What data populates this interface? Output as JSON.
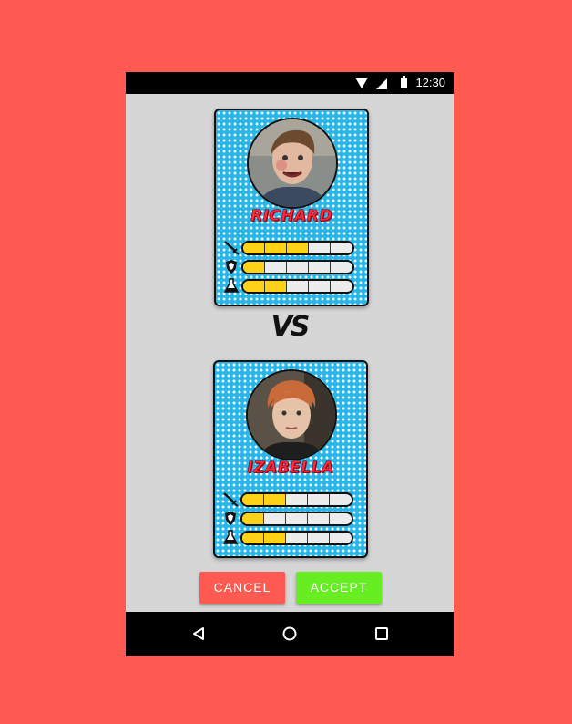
{
  "status_bar": {
    "time": "12:30",
    "icons": [
      "wifi-icon",
      "cell-signal-icon",
      "battery-icon"
    ]
  },
  "cards": [
    {
      "name": "RICHARD",
      "stats": [
        {
          "icon": "sword-icon",
          "filled": 3,
          "total": 5
        },
        {
          "icon": "shield-icon",
          "filled": 1,
          "total": 5
        },
        {
          "icon": "potion-icon",
          "filled": 2,
          "total": 5
        }
      ]
    },
    {
      "name": "IZABELLA",
      "stats": [
        {
          "icon": "sword-icon",
          "filled": 2,
          "total": 5
        },
        {
          "icon": "shield-icon",
          "filled": 1,
          "total": 5
        },
        {
          "icon": "potion-icon",
          "filled": 2,
          "total": 5
        }
      ]
    }
  ],
  "vs_label": "VS",
  "buttons": {
    "cancel": "CANCEL",
    "accept": "ACCEPT"
  },
  "nav": {
    "icons": [
      "back-icon",
      "home-icon",
      "recents-icon"
    ]
  },
  "colors": {
    "background": "#ff5a52",
    "card": "#27b6ea",
    "name": "#ff2a3a",
    "stat_fill": "#ffd21a",
    "cancel": "#ff5a52",
    "accept": "#66ee22"
  }
}
